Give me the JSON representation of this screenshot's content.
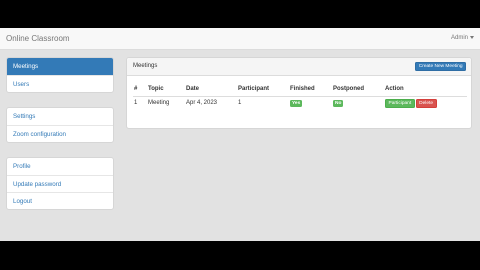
{
  "app": {
    "title": "Online Classroom",
    "user": "Admin"
  },
  "sidebar": {
    "group1": [
      {
        "label": "Meetings",
        "active": true
      },
      {
        "label": "Users",
        "active": false
      }
    ],
    "group2": [
      {
        "label": "Settings"
      },
      {
        "label": "Zoom configuration"
      }
    ],
    "group3": [
      {
        "label": "Profile"
      },
      {
        "label": "Update password"
      },
      {
        "label": "Logout"
      }
    ]
  },
  "main": {
    "panel_title": "Meetings",
    "new_button": "Create New Meeting",
    "table": {
      "headers": [
        "#",
        "Topic",
        "Date",
        "Participant",
        "Finished",
        "Postponed",
        "Action"
      ],
      "rows": [
        {
          "num": "1",
          "topic": "Meeting",
          "date": "Apr 4, 2023",
          "participant": "1",
          "finished": "Yes",
          "postponed": "No",
          "participant_btn": "Participant",
          "delete_btn": "Delete"
        }
      ]
    }
  },
  "colors": {
    "primary": "#337ab7",
    "success": "#5cb85c",
    "danger": "#d9534f"
  }
}
